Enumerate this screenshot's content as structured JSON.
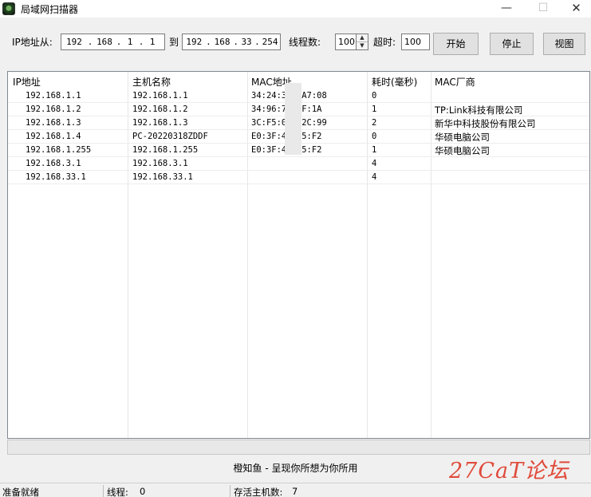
{
  "window": {
    "title": "局域网扫描器",
    "minimize": "—",
    "maximize": "☐",
    "close": "✕"
  },
  "toolbar": {
    "ip_label": "IP地址从:",
    "ip_from": [
      "192",
      "168",
      "1",
      "1"
    ],
    "to_label": "到",
    "ip_to": [
      "192",
      "168",
      "33",
      "254"
    ],
    "threads_label": "线程数:",
    "threads_value": "100",
    "timeout_label": "超时:",
    "timeout_value": "100",
    "start_label": "开始",
    "stop_label": "停止",
    "view_label": "视图"
  },
  "table": {
    "columns": [
      "IP地址",
      "主机名称",
      "MAC地址",
      "耗时(毫秒)",
      "MAC厂商"
    ],
    "rows": [
      {
        "ip": "192.168.1.1",
        "host": "192.168.1.1",
        "mac": "34:24:3  3:A7:08",
        "time": "0",
        "vendor": ""
      },
      {
        "ip": "192.168.1.2",
        "host": "192.168.1.2",
        "mac": "34:96:7  :EF:1A",
        "time": "1",
        "vendor": "TP:Link科技有限公司"
      },
      {
        "ip": "192.168.1.3",
        "host": "192.168.1.3",
        "mac": "3C:F5:0  4:2C:99",
        "time": "2",
        "vendor": "新华中科技股份有限公司"
      },
      {
        "ip": "192.168.1.4",
        "host": "PC-20220318ZDDF",
        "mac": "E0:3F:4  :A5:F2",
        "time": "0",
        "vendor": "华硕电脑公司"
      },
      {
        "ip": "192.168.1.255",
        "host": "192.168.1.255",
        "mac": "E0:3F:4  :A5:F2",
        "time": "1",
        "vendor": "华硕电脑公司"
      },
      {
        "ip": "192.168.3.1",
        "host": "192.168.3.1",
        "mac": "",
        "time": "4",
        "vendor": ""
      },
      {
        "ip": "192.168.33.1",
        "host": "192.168.33.1",
        "mac": "",
        "time": "4",
        "vendor": ""
      }
    ]
  },
  "slogan": "橙知鱼 - 呈现你所想为你所用",
  "watermark": "27CaT论坛",
  "status": {
    "ready": "准备就绪",
    "threads_label": "线程:",
    "threads_value": "0",
    "alive_label": "存活主机数:",
    "alive_value": "7"
  }
}
